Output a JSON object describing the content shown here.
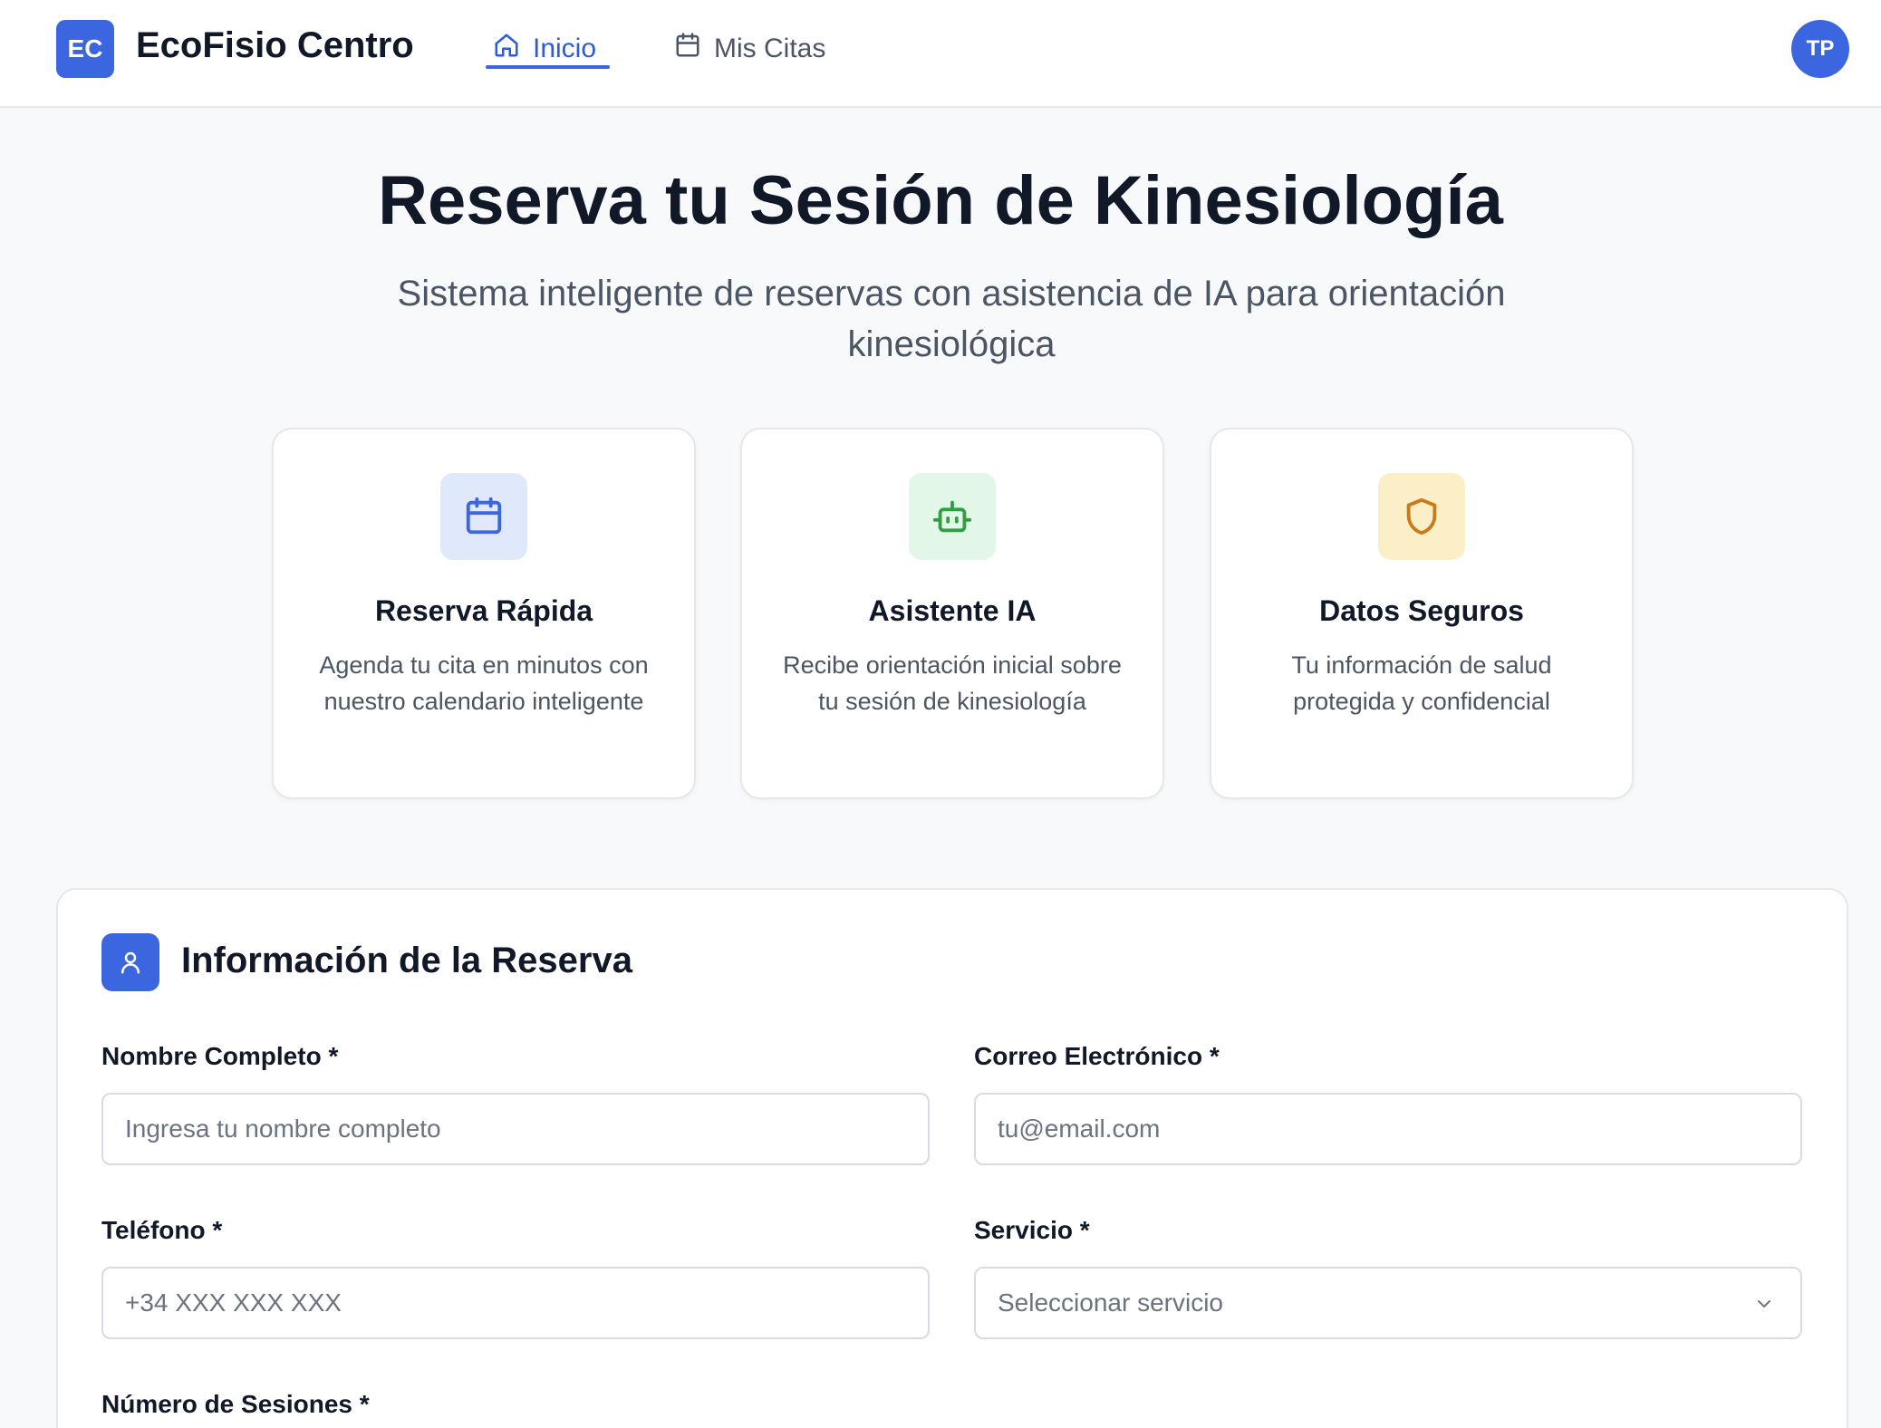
{
  "header": {
    "logo_initials": "EC",
    "app_title": "EcoFisio Centro",
    "nav": [
      {
        "label": "Inicio",
        "icon": "home-icon",
        "active": true
      },
      {
        "label": "Mis Citas",
        "icon": "calendar-icon",
        "active": false
      }
    ],
    "avatar_initials": "TP"
  },
  "hero": {
    "title": "Reserva tu Sesión de Kinesiología",
    "subtitle": "Sistema inteligente de reservas con asistencia de IA para orientación kinesiológica"
  },
  "features": [
    {
      "icon": "calendar-icon",
      "title": "Reserva Rápida",
      "description": "Agenda tu cita en minutos con nuestro calendario inteligente",
      "icon_color": "#3b66e0",
      "icon_bg": "#e0e9fb"
    },
    {
      "icon": "robot-icon",
      "title": "Asistente IA",
      "description": "Recibe orientación inicial sobre tu sesión de kinesiología",
      "icon_color": "#2f9e44",
      "icon_bg": "#e3f7e8"
    },
    {
      "icon": "shield-icon",
      "title": "Datos Seguros",
      "description": "Tu información de salud protegida y confidencial",
      "icon_color": "#c97a1a",
      "icon_bg": "#fcefc7"
    }
  ],
  "form": {
    "title": "Información de la Reserva",
    "icon": "user-icon",
    "name": {
      "label": "Nombre Completo *",
      "placeholder": "Ingresa tu nombre completo",
      "value": ""
    },
    "email": {
      "label": "Correo Electrónico *",
      "placeholder": "tu@email.com",
      "value": ""
    },
    "phone": {
      "label": "Teléfono *",
      "placeholder": "+34 XXX XXX XXX",
      "value": ""
    },
    "service": {
      "label": "Servicio *",
      "selected": "Seleccionar servicio"
    },
    "sessions": {
      "label": "Número de Sesiones *"
    }
  },
  "colors": {
    "accent": "#3b66e0",
    "background": "#f8f9fb"
  }
}
